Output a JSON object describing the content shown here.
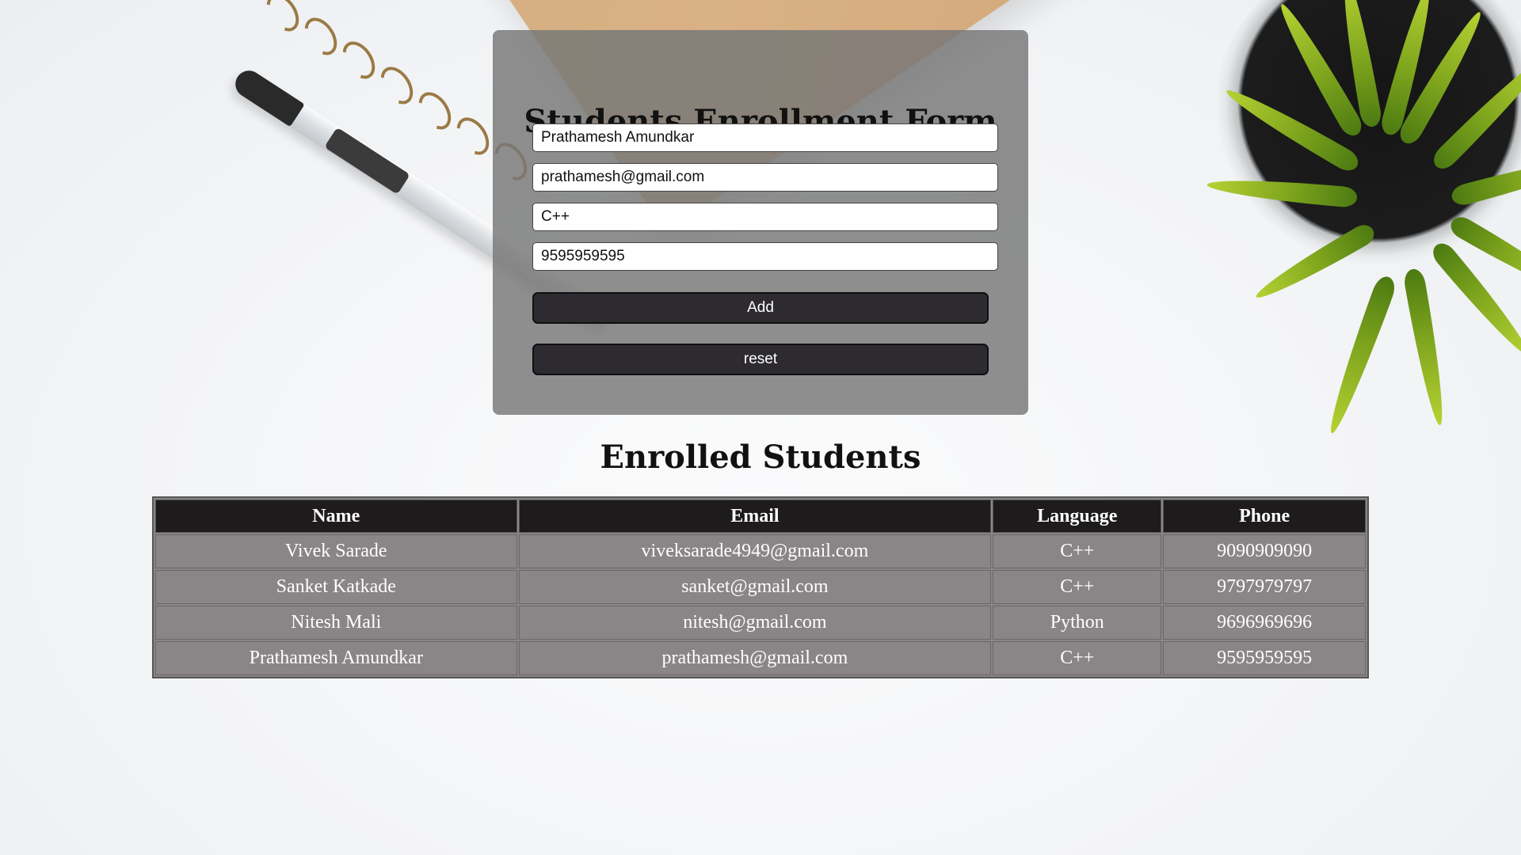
{
  "form": {
    "title": "Students Enrollment Form",
    "name_value": "Prathamesh Amundkar",
    "email_value": "prathamesh@gmail.com",
    "language_value": "C++",
    "phone_value": "9595959595",
    "add_label": "Add",
    "reset_label": "reset"
  },
  "table": {
    "title": "Enrolled Students",
    "headers": [
      "Name",
      "Email",
      "Language",
      "Phone"
    ],
    "rows": [
      [
        "Vivek Sarade",
        "viveksarade4949@gmail.com",
        "C++",
        "9090909090"
      ],
      [
        "Sanket Katkade",
        "sanket@gmail.com",
        "C++",
        "9797979797"
      ],
      [
        "Nitesh Mali",
        "nitesh@gmail.com",
        "Python",
        "9696969696"
      ],
      [
        "Prathamesh Amundkar",
        "prathamesh@gmail.com",
        "C++",
        "9595959595"
      ]
    ]
  },
  "colors": {
    "card_bg": "#767676",
    "button_bg": "#2d2b30",
    "table_header_bg": "#1e1b1c",
    "table_cell_bg": "#8a8586"
  },
  "icons": [
    "notebook-image",
    "pen-image",
    "plant-image"
  ]
}
